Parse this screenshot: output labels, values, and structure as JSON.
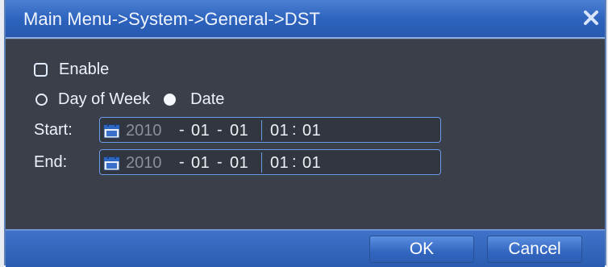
{
  "window": {
    "title": "Main Menu->System->General->DST"
  },
  "enable": {
    "label": "Enable",
    "checked": false
  },
  "mode": {
    "options": [
      {
        "label": "Day of Week",
        "selected": false
      },
      {
        "label": "Date",
        "selected": true
      }
    ]
  },
  "start": {
    "label": "Start:",
    "year": "2010",
    "sep1": "-",
    "month": "01",
    "sep2": "-",
    "day": "01",
    "hour": "01",
    "colon": ":",
    "minute": "01"
  },
  "end": {
    "label": "End:",
    "year": "2010",
    "sep1": "-",
    "month": "01",
    "sep2": "-",
    "day": "01",
    "hour": "01",
    "colon": ":",
    "minute": "01"
  },
  "footer": {
    "ok_label": "OK",
    "cancel_label": "Cancel"
  },
  "icons": {
    "close": "close-icon",
    "calendar": "calendar-icon"
  },
  "colors": {
    "titlebar": "#2d62bd",
    "field_border": "#6a9be8",
    "background": "#3a3f49"
  }
}
